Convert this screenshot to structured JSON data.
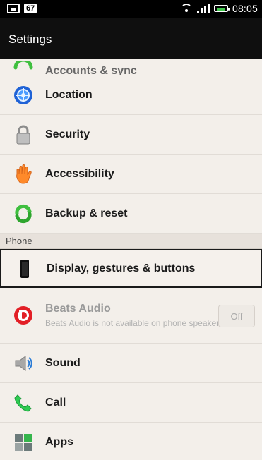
{
  "status_bar": {
    "left_badge": "67",
    "clock": "08:05"
  },
  "header": {
    "title": "Settings"
  },
  "list": {
    "partial_item_label": "Accounts & sync",
    "items": [
      {
        "label": "Location"
      },
      {
        "label": "Security"
      },
      {
        "label": "Accessibility"
      },
      {
        "label": "Backup & reset"
      }
    ],
    "section_phone": "Phone",
    "phone_items": [
      {
        "label": "Display, gestures & buttons"
      },
      {
        "label": "Beats Audio",
        "desc": "Beats Audio is not available on phone speaker",
        "toggle": "Off"
      },
      {
        "label": "Sound"
      },
      {
        "label": "Call"
      },
      {
        "label": "Apps"
      }
    ]
  },
  "colors": {
    "bg": "#f3efea",
    "header": "#0f0f0f",
    "section_bg": "#e7e1db",
    "accent_green": "#41c64d"
  }
}
